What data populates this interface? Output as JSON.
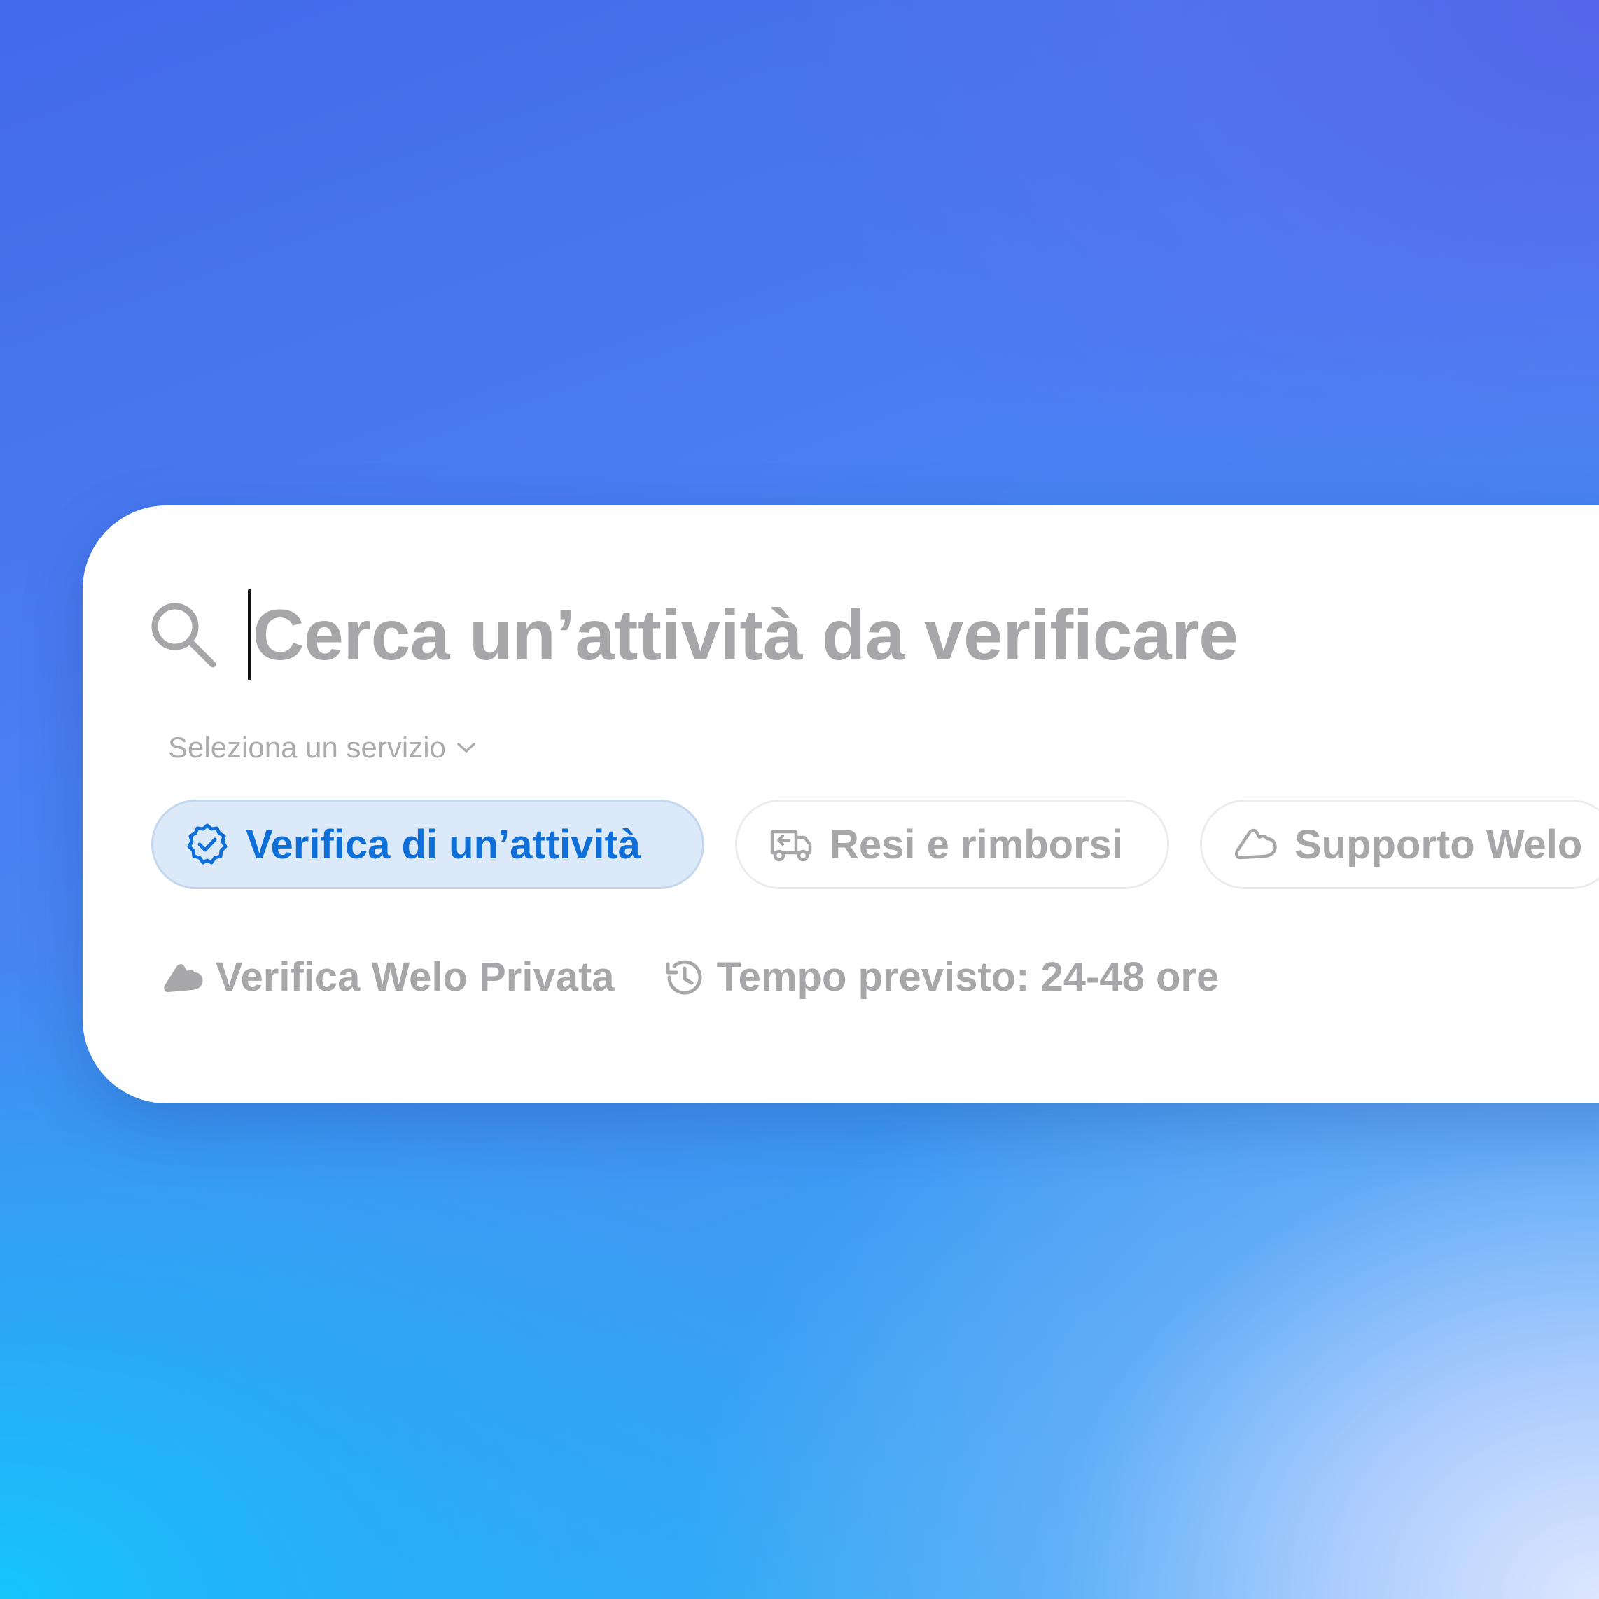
{
  "search": {
    "placeholder": "Cerca un’attività da verificare",
    "icon": "search-icon"
  },
  "service_select": {
    "label": "Seleziona un servizio",
    "icon": "chevron-down-icon"
  },
  "chips": [
    {
      "label": "Verifica di un’attività",
      "icon": "verified-badge-icon",
      "active": true
    },
    {
      "label": "Resi e rimborsi",
      "icon": "truck-return-icon",
      "active": false
    },
    {
      "label": "Supporto Welo",
      "icon": "cloud-icon",
      "active": false
    }
  ],
  "meta": {
    "privacy_label": "Verifica Welo Privata",
    "privacy_icon": "cloud-filled-icon",
    "time_label": "Tempo previsto: 24-48 ore",
    "time_icon": "history-icon"
  },
  "colors": {
    "accent": "#0f6fd8",
    "active_chip_bg": "#dbe9f9",
    "muted_text": "#a7a7a9"
  }
}
